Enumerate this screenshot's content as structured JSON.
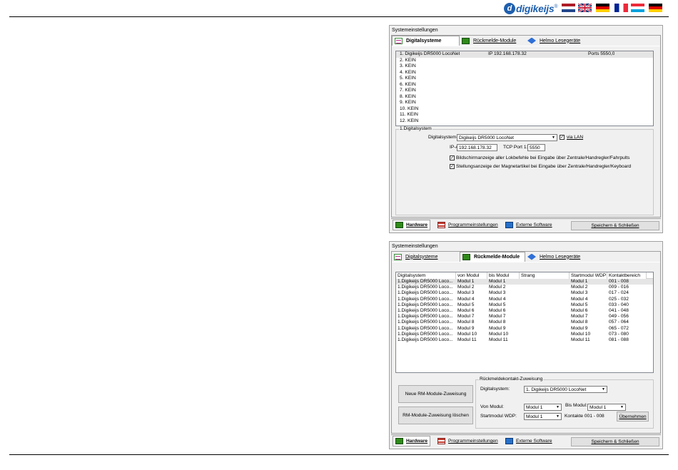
{
  "header": {
    "logo_text": "digikeijs",
    "logo_mark": "d",
    "trademark": "®",
    "flags": [
      {
        "name": "nl-flag",
        "colors": [
          "#ae1c28",
          "#ffffff",
          "#21468b"
        ]
      },
      {
        "name": "uk-flag",
        "colors": [
          "#012169",
          "#ffffff",
          "#c8102e"
        ]
      },
      {
        "name": "de-flag",
        "colors": [
          "#000000",
          "#dd0000",
          "#ffce00"
        ]
      },
      {
        "name": "fr-flag",
        "colors": [
          "#002395",
          "#ffffff",
          "#ed2939"
        ]
      },
      {
        "name": "lu-flag",
        "colors": [
          "#ed2939",
          "#ffffff",
          "#00a1de"
        ]
      },
      {
        "name": "de2-flag",
        "colors": [
          "#000000",
          "#dd0000",
          "#ffce00"
        ]
      }
    ]
  },
  "window1": {
    "title": "Systemeinstellungen",
    "tabs": [
      {
        "label": "Digitalsysteme",
        "icon": "digital-systems-icon",
        "active": true
      },
      {
        "label": "Rückmelde-Module",
        "icon": "feedback-module-icon",
        "active": false
      },
      {
        "label": "Helmo Lesegeräte",
        "icon": "helmo-reader-icon",
        "active": false
      }
    ],
    "list": [
      {
        "name": "1. Digikeijs DR5000 LocoNet",
        "ip": "IP 192.168.178.32",
        "port": "Ports 5550,0"
      },
      {
        "name": "2. KEIN",
        "ip": "",
        "port": ""
      },
      {
        "name": "3. KEIN",
        "ip": "",
        "port": ""
      },
      {
        "name": "4. KEIN",
        "ip": "",
        "port": ""
      },
      {
        "name": "5. KEIN",
        "ip": "",
        "port": ""
      },
      {
        "name": "6. KEIN",
        "ip": "",
        "port": ""
      },
      {
        "name": "7. KEIN",
        "ip": "",
        "port": ""
      },
      {
        "name": "8. KEIN",
        "ip": "",
        "port": ""
      },
      {
        "name": "9. KEIN",
        "ip": "",
        "port": ""
      },
      {
        "name": "10. KEIN",
        "ip": "",
        "port": ""
      },
      {
        "name": "11. KEIN",
        "ip": "",
        "port": ""
      },
      {
        "name": "12. KEIN",
        "ip": "",
        "port": ""
      }
    ],
    "group_title": "1.Digitalsystem",
    "type_label": "Digitalsystem-Typ:",
    "type_value": "Digikeijs DR5000 LocoNet",
    "lan_label": "via LAN",
    "ip_label": "IP-Adresse:",
    "ip_value": "192.168.178.32",
    "port_label": "TCP Port 1:",
    "port_value": "5550",
    "check1": "Bildschirmanzeige aller Lokbefehle bei Eingabe über Zentrale/Handregler/Fahrpults",
    "check2": "Stellungsanzeige der Magnetartikel bei Eingabe über Zentrale/Handregler/Keyboard",
    "bottom_tabs": [
      {
        "label": "Hardware",
        "icon": "hardware-icon",
        "active": true
      },
      {
        "label": "Programmeinstellungen",
        "icon": "program-settings-icon",
        "active": false
      },
      {
        "label": "Externe Software",
        "icon": "external-software-icon",
        "active": false
      }
    ],
    "save_button": "Speichern & Schließen"
  },
  "window2": {
    "title": "Systemeinstellungen",
    "tabs": [
      {
        "label": "Digitalsysteme",
        "icon": "digital-systems-icon",
        "active": false
      },
      {
        "label": "Rückmelde-Module",
        "icon": "feedback-module-icon",
        "active": true
      },
      {
        "label": "Helmo Lesegeräte",
        "icon": "helmo-reader-icon",
        "active": false
      }
    ],
    "columns": [
      "Digitalsystem",
      "von Modul",
      "bis Modul",
      "Strang",
      "Startmodul WDP",
      "Kontaktbereich"
    ],
    "rows": [
      [
        "1.Digikeijs DR5000 Loco...",
        "Modul 1",
        "Modul 1",
        "",
        "Modul 1",
        "001 - 008"
      ],
      [
        "1.Digikeijs DR5000 Loco...",
        "Modul 2",
        "Modul 2",
        "",
        "Modul 2",
        "009 - 016"
      ],
      [
        "1.Digikeijs DR5000 Loco...",
        "Modul 3",
        "Modul 3",
        "",
        "Modul 3",
        "017 - 024"
      ],
      [
        "1.Digikeijs DR5000 Loco...",
        "Modul 4",
        "Modul 4",
        "",
        "Modul 4",
        "025 - 032"
      ],
      [
        "1.Digikeijs DR5000 Loco...",
        "Modul 5",
        "Modul 5",
        "",
        "Modul 5",
        "033 - 040"
      ],
      [
        "1.Digikeijs DR5000 Loco...",
        "Modul 6",
        "Modul 6",
        "",
        "Modul 6",
        "041 - 048"
      ],
      [
        "1.Digikeijs DR5000 Loco...",
        "Modul 7",
        "Modul 7",
        "",
        "Modul 7",
        "049 - 056"
      ],
      [
        "1.Digikeijs DR5000 Loco...",
        "Modul 8",
        "Modul 8",
        "",
        "Modul 8",
        "057 - 064"
      ],
      [
        "1.Digikeijs DR5000 Loco...",
        "Modul 9",
        "Modul 9",
        "",
        "Modul 9",
        "065 - 072"
      ],
      [
        "1.Digikeijs DR5000 Loco...",
        "Modul 10",
        "Modul 10",
        "",
        "Modul 10",
        "073 - 080"
      ],
      [
        "1.Digikeijs DR5000 Loco...",
        "Modul 11",
        "Modul 11",
        "",
        "Modul 11",
        "081 - 088"
      ]
    ],
    "new_button": "Neue RM-Module-Zuweisung",
    "delete_button": "RM-Module-Zuweisung löschen",
    "group_title": "Rückmeldekontakt-Zuweisung",
    "ds_label": "Digitalsystem:",
    "ds_value": "1. Digikeijs DR5000 LocoNet",
    "from_label": "Von Modul:",
    "from_value": "Modul 1",
    "to_label": "Bis Modul:",
    "to_value": "Modul 1",
    "start_label": "Startmodul WDP:",
    "start_value": "Modul 1",
    "contacts_text": "Kontakte 001 - 008",
    "apply_button": "Übernehmen",
    "bottom_tabs": [
      {
        "label": "Hardware",
        "icon": "hardware-icon",
        "active": true
      },
      {
        "label": "Programmeinstellungen",
        "icon": "program-settings-icon",
        "active": false
      },
      {
        "label": "Externe Software",
        "icon": "external-software-icon",
        "active": false
      }
    ],
    "save_button": "Speichern & Schließen"
  }
}
